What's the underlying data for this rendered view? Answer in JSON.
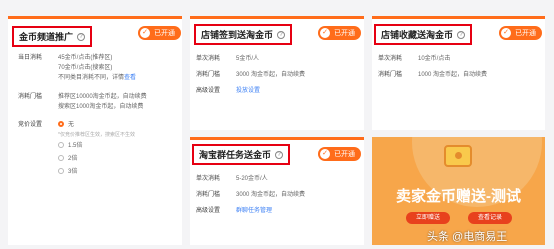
{
  "cards": {
    "coin_channel": {
      "title": "金币频道推广",
      "badge": "已开通",
      "rows": {
        "daily_cost_label": "当日消耗",
        "daily_cost_line1": "45金币/点击(推荐区)",
        "daily_cost_line2": "70金币/点击(搜索区)",
        "daily_cost_line3_prefix": "不同类目消耗不同，详情",
        "daily_cost_line3_link": "查看",
        "threshold_label": "消耗门槛",
        "threshold_line1": "推荐区10000淘金币起，自动续费",
        "threshold_line2": "搜索区1000淘金币起，自动续费",
        "bid_label": "竞价设置",
        "bid_options": [
          "无",
          "1.5倍",
          "2倍",
          "3倍"
        ],
        "bid_note": "*仅竞价推荐区生效，搜索区不生效"
      }
    },
    "store_checkin": {
      "title": "店铺签到送淘金币",
      "badge": "已开通",
      "rows": {
        "single_cost_label": "单次消耗",
        "single_cost_value": "5金币/人",
        "threshold_label": "消耗门槛",
        "threshold_value": "3000 淘金币起，自动续费",
        "advanced_label": "高级设置",
        "advanced_link": "投放设置"
      }
    },
    "store_favorite": {
      "title": "店铺收藏送淘金币",
      "badge": "已开通",
      "rows": {
        "single_cost_label": "单次消耗",
        "single_cost_value": "10金币/点击",
        "threshold_label": "消耗门槛",
        "threshold_value": "1000 淘金币起，自动续费"
      }
    },
    "group_task": {
      "title": "淘宝群任务送金币",
      "badge": "已开通",
      "rows": {
        "single_cost_label": "单次消耗",
        "single_cost_value": "5-20金币/人",
        "threshold_label": "消耗门槛",
        "threshold_value": "3000 淘金币起，自动续费",
        "advanced_label": "高级设置",
        "advanced_link": "群聊任务管理"
      }
    }
  },
  "promo": {
    "title": "卖家金币赠送-测试",
    "button_left": "立即赠送",
    "button_right": "查看记录"
  },
  "watermark": "头条 @电商易王",
  "colors": {
    "accent": "#ff6c1a",
    "highlight_box": "#e60012",
    "link": "#3f82f5",
    "promo_bg": "#f7a64a"
  }
}
